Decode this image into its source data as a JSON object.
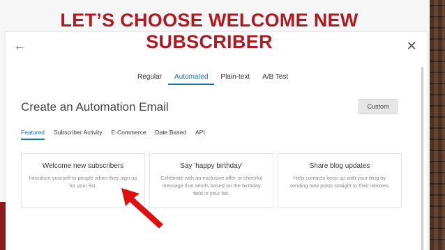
{
  "slide": {
    "title_line1": "LET’S CHOOSE WELCOME NEW",
    "title_line2": "SUBSCRIBER"
  },
  "modal": {
    "type_tabs": [
      "Regular",
      "Automated",
      "Plain-text",
      "A/B Test"
    ],
    "active_type_tab": "Automated",
    "page_title": "Create an Automation Email",
    "custom_label": "Custom",
    "category_tabs": [
      "Featured",
      "Subscriber Activity",
      "E-Commerce",
      "Date Based",
      "API"
    ],
    "active_category_tab": "Featured",
    "cards": [
      {
        "title": "Welcome new subscribers",
        "desc": "Introduce yourself to people when they sign up for your list."
      },
      {
        "title": "Say 'happy birthday'",
        "desc": "Celebrate with an exclusive offer or cheerful message that sends based on the birthday field in your list."
      },
      {
        "title": "Share blog updates",
        "desc": "Help contacts keep up with your blog by sending new posts straight to their inboxes."
      }
    ]
  },
  "icons": {
    "back": "arrow-left-icon",
    "close": "close-icon",
    "pointer": "red-arrow"
  },
  "colors": {
    "title_red": "#b0191f",
    "accent_blue": "#1a6fa3",
    "arrow_red": "#e01010"
  }
}
